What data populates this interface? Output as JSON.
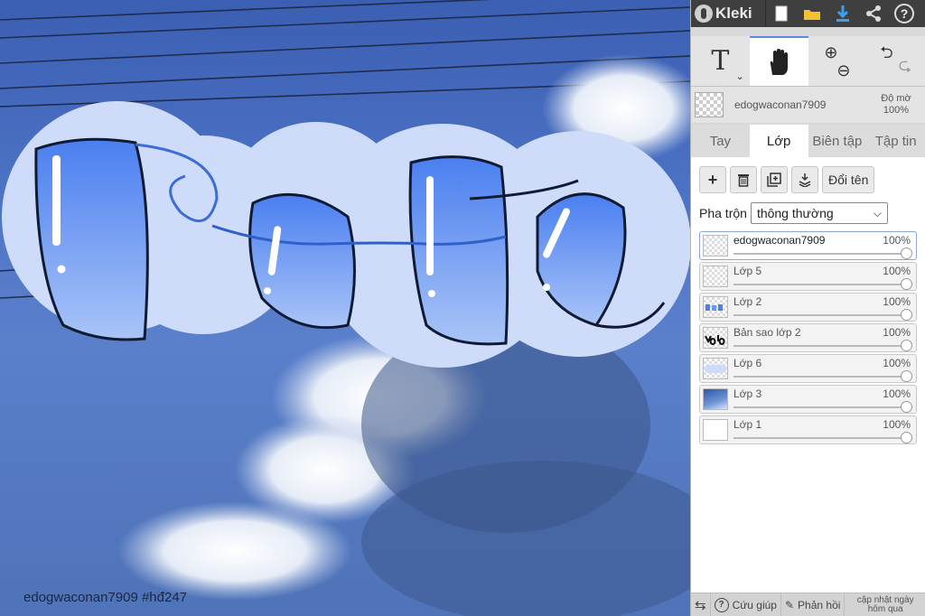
{
  "canvas": {
    "caption": "edogwaconan7909   #hđ247",
    "art_text": "vote"
  },
  "topbar": {
    "app_name": "Kleki",
    "new_icon": "new-file-icon",
    "open_icon": "folder-icon",
    "download_icon": "download-icon",
    "share_icon": "share-icon",
    "help_label": "?"
  },
  "tools": {
    "text_label": "T",
    "text_dropdown": "⌄",
    "hand_icon": "hand-icon",
    "zoom_in": "⊕",
    "zoom_out": "⊖",
    "undo": "⮌",
    "redo": "⮎"
  },
  "brush": {
    "name": "edogwaconan7909",
    "opacity_label": "Độ mờ",
    "opacity_value": "100%"
  },
  "tabs": [
    {
      "label": "Tay"
    },
    {
      "label": "Lớp"
    },
    {
      "label": "Biên tập"
    },
    {
      "label": "Tập tin"
    }
  ],
  "layer_tools": {
    "add": "+",
    "delete": "🗑",
    "duplicate": "⧉",
    "merge": "⤓",
    "rename": "Đổi tên"
  },
  "blend": {
    "label": "Pha trộn",
    "value": "thông thường"
  },
  "layers": [
    {
      "name": "edogwaconan7909",
      "opacity": "100%"
    },
    {
      "name": "Lớp 5",
      "opacity": "100%"
    },
    {
      "name": "Lớp 2",
      "opacity": "100%"
    },
    {
      "name": "Bản sao lớp 2",
      "opacity": "100%"
    },
    {
      "name": "Lớp 6",
      "opacity": "100%"
    },
    {
      "name": "Lớp 3",
      "opacity": "100%"
    },
    {
      "name": "Lớp 1",
      "opacity": "100%"
    }
  ],
  "footer": {
    "swap": "⇆",
    "help": "Cứu giúp",
    "feedback": "Phản hồi",
    "update": "cập nhật ngày hôm qua"
  },
  "colors": {
    "sky": "#4c72c4",
    "bubble": "#cfdcf9",
    "letter_top": "#4a7ff0",
    "letter_bottom": "#a9c4f7"
  }
}
